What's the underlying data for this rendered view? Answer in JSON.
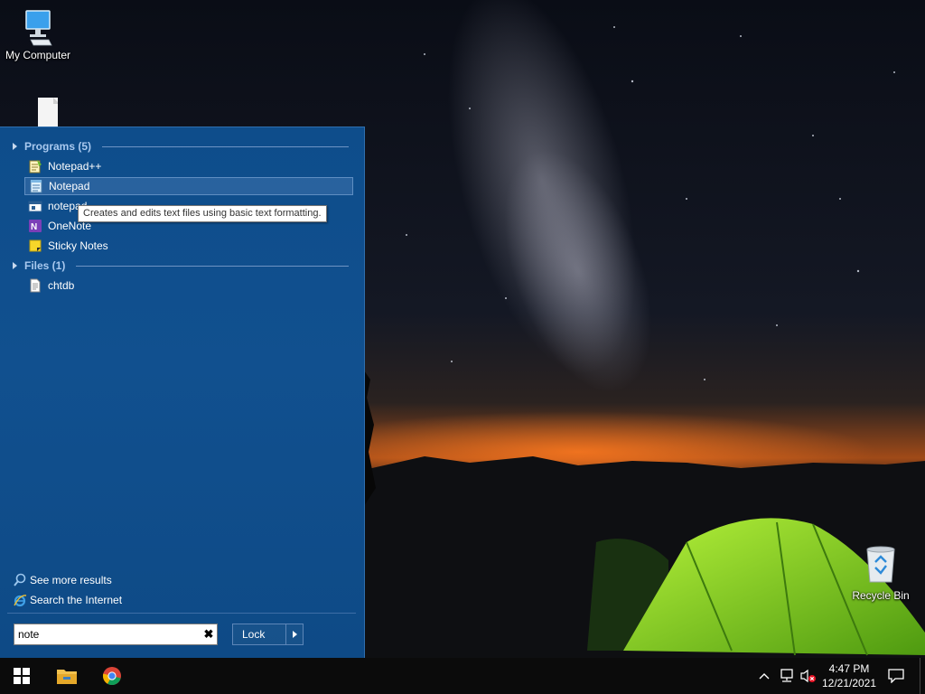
{
  "desktop": {
    "icons": {
      "my_computer": "My Computer",
      "file": "",
      "recycle_bin": "Recycle Bin"
    }
  },
  "start_menu": {
    "sections": [
      {
        "header": "Programs (5)",
        "items": [
          {
            "label": "Notepad++",
            "icon": "notepadplusplus-icon"
          },
          {
            "label": "Notepad",
            "icon": "notepad-icon",
            "selected": true
          },
          {
            "label": "notepad",
            "icon": "notepad-app-icon"
          },
          {
            "label": "OneNote",
            "icon": "onenote-icon"
          },
          {
            "label": "Sticky Notes",
            "icon": "sticky-notes-icon"
          }
        ]
      },
      {
        "header": "Files (1)",
        "items": [
          {
            "label": "chtdb",
            "icon": "text-file-icon"
          }
        ]
      }
    ],
    "see_more_results": "See more results",
    "search_internet": "Search the Internet",
    "search": {
      "value": "note"
    },
    "lock_label": "Lock"
  },
  "tooltip": "Creates and edits text files using basic text formatting.",
  "taskbar": {
    "clock": {
      "time": "4:47 PM",
      "date": "12/21/2021"
    }
  },
  "colors": {
    "start_menu_bg": "#0e4d8b",
    "section_header": "#a9c9ef",
    "taskbar_bg": "#0b0b0b",
    "tent_green": "#7ed321"
  }
}
